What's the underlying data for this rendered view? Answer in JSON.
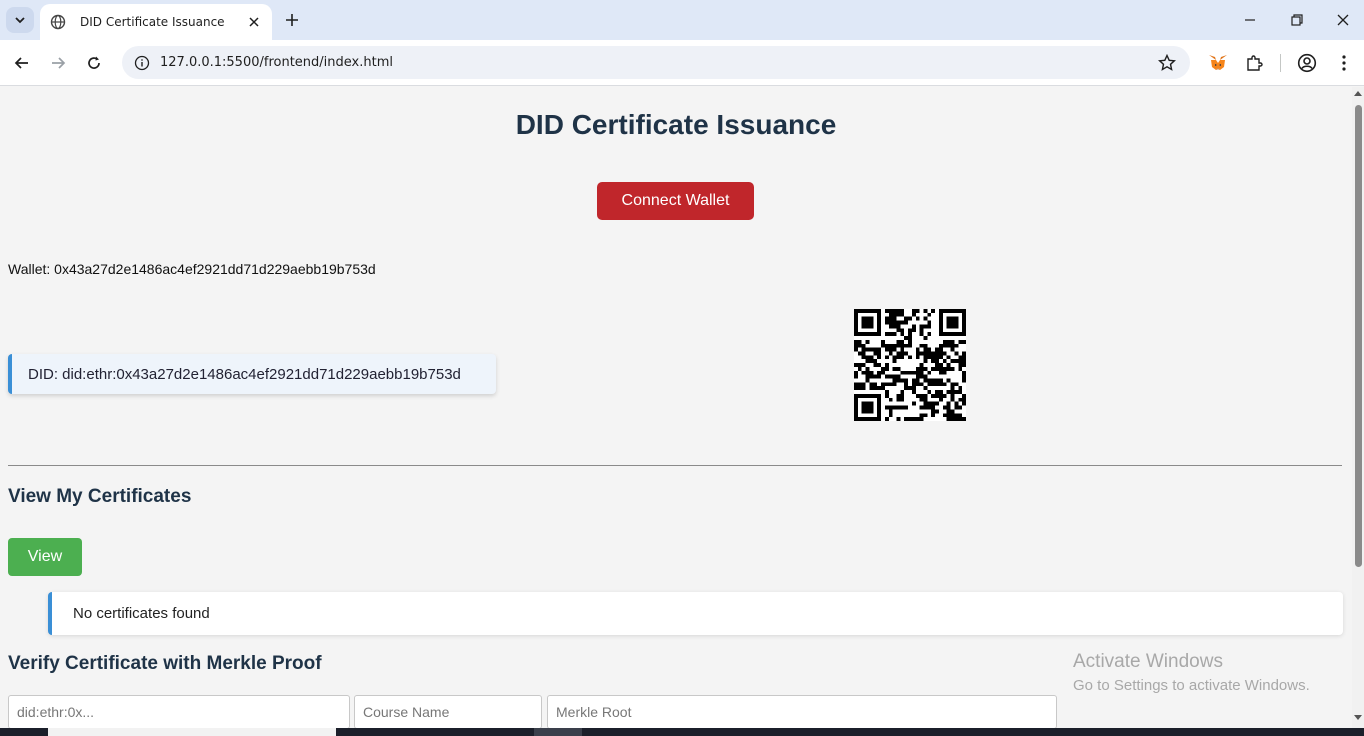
{
  "browser": {
    "tab_title": "DID Certificate Issuance",
    "url": "127.0.0.1:5500/frontend/index.html"
  },
  "icons": {
    "tab_search": "chevron-down-icon",
    "favicon": "globe-icon",
    "tab_close": "close-icon",
    "new_tab": "plus-icon",
    "back": "back-arrow-icon",
    "forward": "forward-arrow-icon",
    "reload": "reload-icon",
    "site_info": "info-icon",
    "bookmark": "star-icon",
    "metamask": "metamask-fox-icon",
    "extensions": "puzzle-icon",
    "profile": "profile-icon",
    "menu": "kebab-menu-icon"
  },
  "page": {
    "title": "DID Certificate Issuance",
    "connect_button": "Connect Wallet",
    "wallet_text": "Wallet: 0x43a27d2e1486ac4ef2921dd71d229aebb19b753d",
    "did_text": "DID: did:ethr:0x43a27d2e1486ac4ef2921dd71d229aebb19b753d",
    "view_section_title": "View My Certificates",
    "view_button": "View",
    "no_certificates": "No certificates found",
    "verify_section_title": "Verify Certificate with Merkle Proof",
    "inputs": {
      "did_placeholder": "did:ethr:0x...",
      "course_placeholder": "Course Name",
      "merkle_placeholder": "Merkle Root"
    }
  },
  "watermark": {
    "title": "Activate Windows",
    "subtitle": "Go to Settings to activate Windows."
  },
  "colors": {
    "connect_button": "#c0262b",
    "view_button": "#4caf50",
    "accent_border": "#3a8fd6",
    "heading": "#1f3347"
  }
}
